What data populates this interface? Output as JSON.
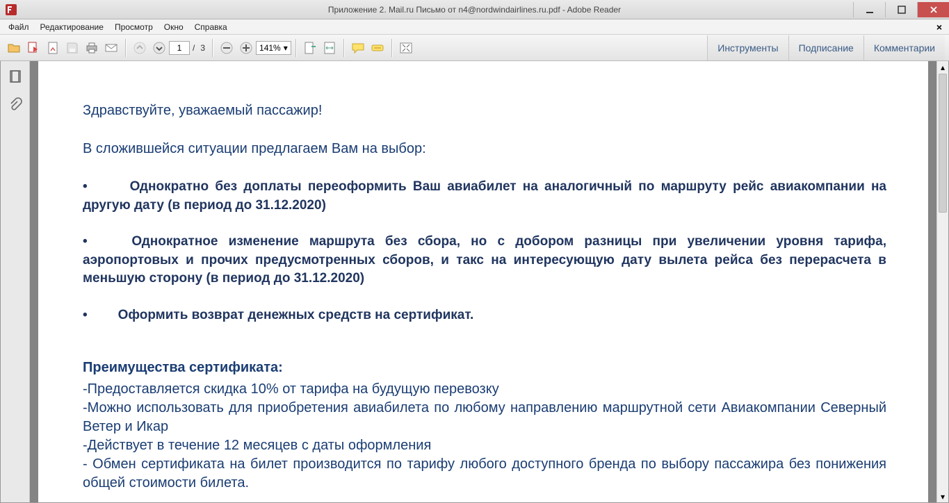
{
  "window": {
    "title": "Приложение 2. Mail.ru Письмо от n4@nordwindairlines.ru.pdf - Adobe Reader"
  },
  "menu": {
    "items": [
      "Файл",
      "Редактирование",
      "Просмотр",
      "Окно",
      "Справка"
    ],
    "close_doc": "×"
  },
  "toolbar": {
    "page_current": "1",
    "page_sep": "/",
    "page_total": "3",
    "zoom": "141%"
  },
  "right_panel": {
    "tools": "Инструменты",
    "sign": "Подписание",
    "comments": "Комментарии"
  },
  "doc": {
    "greeting": "Здравствуйте, уважаемый пассажир!",
    "intro": "В сложившейся ситуации предлагаем Вам на выбор:",
    "b1": "Однократно без доплаты переоформить Ваш авиабилет на аналогичный по маршруту рейс авиакомпании на другую дату (в период до 31.12.2020)",
    "b2": "Однократное изменение маршрута без сбора, но с добором разницы при увеличении уровня тарифа, аэропортовых и прочих предусмотренных сборов, и такс на интересующую дату вылета рейса без перерасчета в меньшую сторону (в период до 31.12.2020)",
    "b3": "Оформить возврат денежных средств на сертификат.",
    "adv_title": "Преимущества сертификата:",
    "adv1": "-Предоставляется скидка 10% от тарифа на будущую перевозку",
    "adv2": "-Можно использовать для приобретения авиабилета по любому направлению маршрутной сети Авиакомпании Северный Ветер и Икар",
    "adv3": "-Действует в течение 12 месяцев с даты оформления",
    "adv4": "- Обмен сертификата на билет производится по тарифу любого доступного бренда по выбору пассажира без понижения общей стоимости билета."
  }
}
